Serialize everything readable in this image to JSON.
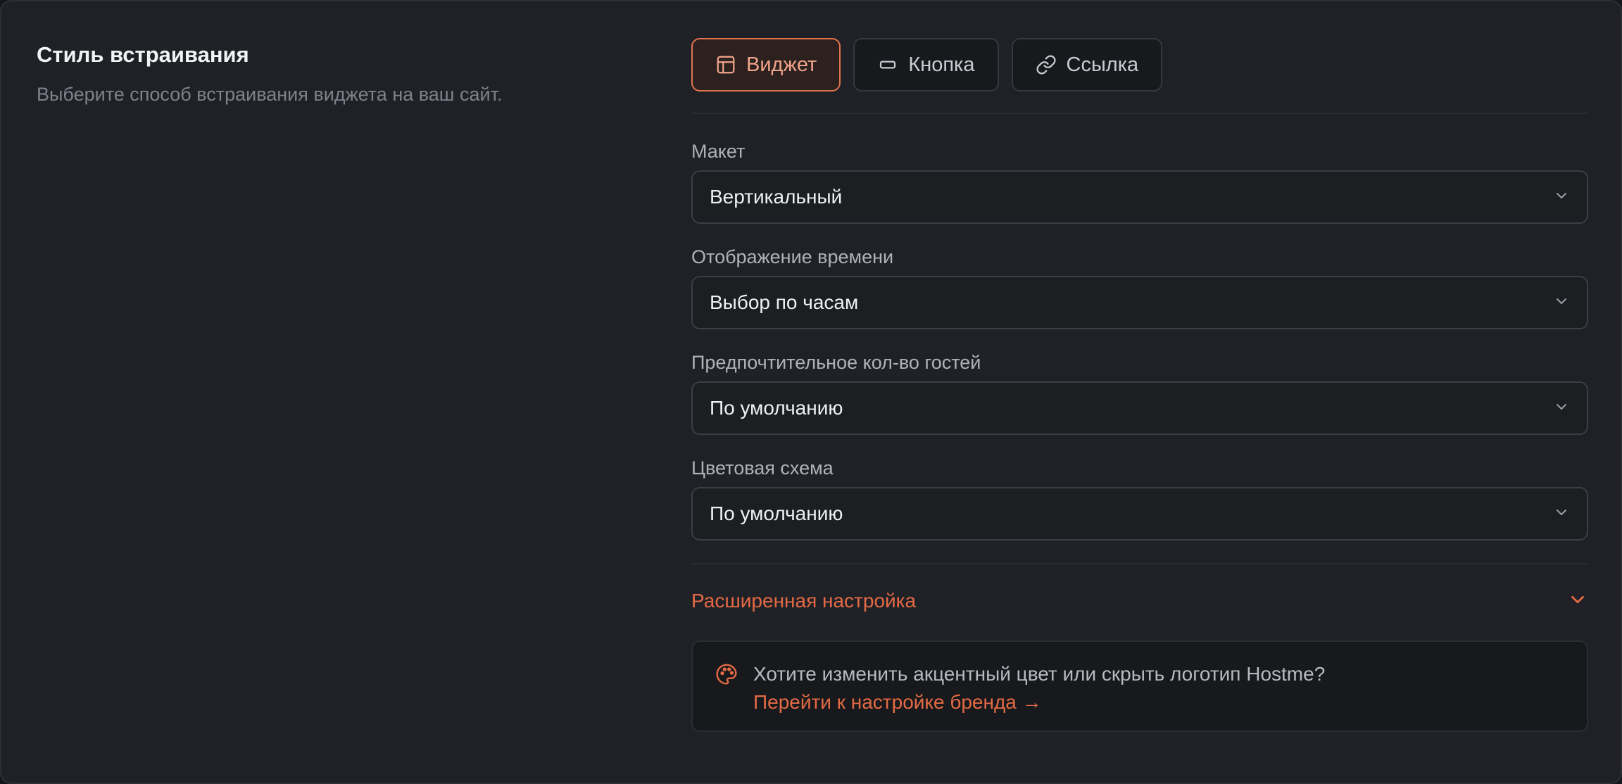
{
  "section": {
    "title": "Стиль встраивания",
    "description": "Выберите способ встраивания виджета на ваш сайт."
  },
  "tabs": [
    {
      "label": "Виджет",
      "icon": "layout-icon",
      "active": true
    },
    {
      "label": "Кнопка",
      "icon": "button-icon",
      "active": false
    },
    {
      "label": "Ссылка",
      "icon": "link-icon",
      "active": false
    }
  ],
  "fields": {
    "layout": {
      "label": "Макет",
      "value": "Вертикальный"
    },
    "time_display": {
      "label": "Отображение времени",
      "value": "Выбор по часам"
    },
    "guests": {
      "label": "Предпочтительное кол-во гостей",
      "value": "По умолчанию"
    },
    "color_scheme": {
      "label": "Цветовая схема",
      "value": "По умолчанию"
    }
  },
  "advanced": {
    "label": "Расширенная настройка"
  },
  "info": {
    "text": "Хотите изменить акцентный цвет или скрыть логотип Hostme?",
    "link": "Перейти к настройке бренда →",
    "icon": "palette-icon"
  },
  "colors": {
    "accent": "#e46a44",
    "background": "#1f2126"
  }
}
